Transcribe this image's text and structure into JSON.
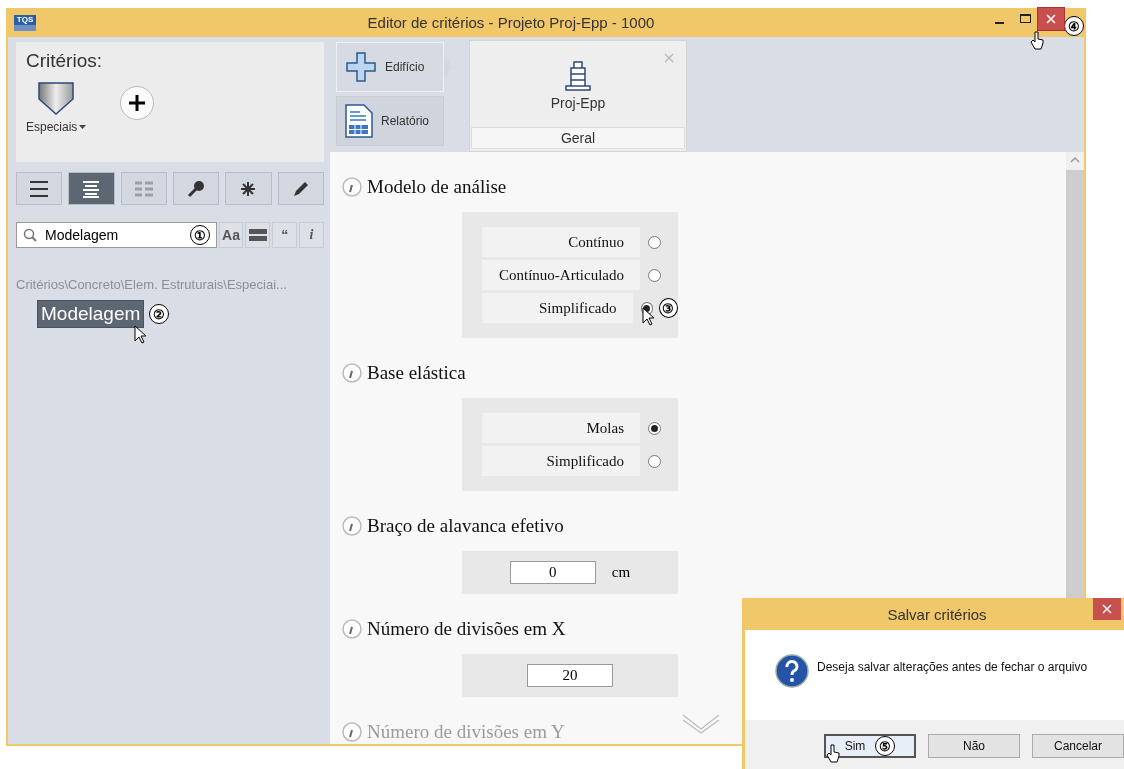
{
  "window": {
    "app_logo": "TQS",
    "title": "Editor de critérios - Projeto Proj-Epp - 1000",
    "controls": [
      {
        "kind": "minimize",
        "hovered": false
      },
      {
        "kind": "maximize",
        "hovered": false
      },
      {
        "kind": "close",
        "hovered": true,
        "callout": "④"
      }
    ]
  },
  "sidebar": {
    "heading": "Critérios:",
    "category": "Especiais",
    "view_buttons": [
      {
        "kind": "list",
        "selected": false
      },
      {
        "kind": "lines",
        "selected": true
      },
      {
        "kind": "grid",
        "selected": false
      },
      {
        "kind": "key",
        "selected": false
      },
      {
        "kind": "asterisk",
        "selected": false
      },
      {
        "kind": "pencil",
        "selected": false
      }
    ],
    "search": {
      "value": "Modelagem",
      "callout": "①"
    },
    "search_options": [
      {
        "kind": "text",
        "label": "Aa"
      },
      {
        "kind": "bars"
      },
      {
        "kind": "text",
        "label": "“"
      },
      {
        "kind": "italic",
        "label": "i"
      }
    ],
    "breadcrumb": "Critérios\\Concreto\\Elem. Estruturais\\Especiai...",
    "items": [
      {
        "label": "Modelagem",
        "selected": true,
        "hovered": true,
        "callout": "②"
      }
    ]
  },
  "nav": {
    "buttons": [
      {
        "kind": "add",
        "label": "Edifício",
        "selected": true
      },
      {
        "kind": "report",
        "label": "Relatório",
        "selected": false
      }
    ],
    "tab": {
      "title": "Proj-Epp",
      "subtitle": "Geral"
    }
  },
  "sections": [
    {
      "kind": "radio",
      "title": "Modelo de análise",
      "options": [
        {
          "label": "Contínuo",
          "selected": false
        },
        {
          "label": "Contínuo-Articulado",
          "selected": false
        },
        {
          "label": "Simplificado",
          "selected": true,
          "callout": "③"
        }
      ]
    },
    {
      "kind": "radio",
      "title": "Base elástica",
      "options": [
        {
          "label": "Molas",
          "selected": true
        },
        {
          "label": "Simplificado",
          "selected": false
        }
      ]
    },
    {
      "kind": "number",
      "title": "Braço de alavanca efetivo",
      "value": "0",
      "unit": "cm"
    },
    {
      "kind": "number",
      "title": "Número de divisões em X",
      "value": "20"
    },
    {
      "kind": "faded",
      "title": "Número de divisões em Y"
    }
  ],
  "dialog": {
    "title": "Salvar critérios",
    "message": "Deseja salvar alterações antes de fechar o arquivo",
    "buttons": [
      {
        "label": "Sim",
        "focused": true,
        "hovered": true,
        "callout": "⑤"
      },
      {
        "label": "Não",
        "focused": false,
        "hovered": false
      },
      {
        "label": "Cancelar",
        "focused": false,
        "hovered": false
      }
    ]
  }
}
